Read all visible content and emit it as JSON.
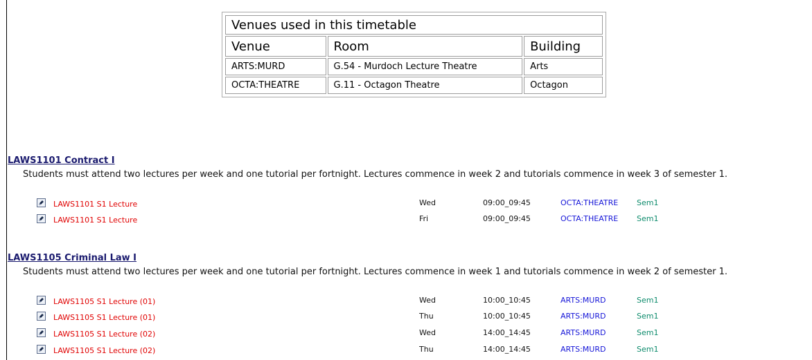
{
  "venues_table": {
    "caption": "Venues used in this timetable",
    "headers": {
      "venue": "Venue",
      "room": "Room",
      "building": "Building"
    },
    "rows": [
      {
        "venue": "ARTS:MURD",
        "room": "G.54 - Murdoch Lecture Theatre",
        "building": "Arts"
      },
      {
        "venue": "OCTA:THEATRE",
        "room": "G.11 - Octagon Theatre",
        "building": "Octagon"
      }
    ]
  },
  "courses": [
    {
      "title": "LAWS1101 Contract I",
      "description": "Students must attend two lectures per week and one tutorial per fortnight. Lectures commence in week 2 and tutorials commence in week 3 of semester 1.",
      "activities": [
        {
          "name": "LAWS1101 S1 Lecture",
          "day": "Wed",
          "time": "09:00_09:45",
          "venue": "OCTA:THEATRE",
          "semester": "Sem1"
        },
        {
          "name": "LAWS1101 S1 Lecture",
          "day": "Fri",
          "time": "09:00_09:45",
          "venue": "OCTA:THEATRE",
          "semester": "Sem1"
        }
      ]
    },
    {
      "title": "LAWS1105 Criminal Law I",
      "description": "Students must attend two lectures per week and one tutorial per fortnight. Lectures commence in week 1 and tutorials commence in week 2 of semester 1.",
      "activities": [
        {
          "name": "LAWS1105 S1 Lecture (01)",
          "day": "Wed",
          "time": "10:00_10:45",
          "venue": "ARTS:MURD",
          "semester": "Sem1"
        },
        {
          "name": "LAWS1105 S1 Lecture (01)",
          "day": "Thu",
          "time": "10:00_10:45",
          "venue": "ARTS:MURD",
          "semester": "Sem1"
        },
        {
          "name": "LAWS1105 S1 Lecture (02)",
          "day": "Wed",
          "time": "14:00_14:45",
          "venue": "ARTS:MURD",
          "semester": "Sem1"
        },
        {
          "name": "LAWS1105 S1 Lecture (02)",
          "day": "Thu",
          "time": "14:00_14:45",
          "venue": "ARTS:MURD",
          "semester": "Sem1"
        }
      ]
    }
  ],
  "icons": {
    "activity_icon": "edit-pen-icon"
  },
  "colors": {
    "activity_link": "#e00000",
    "venue_link": "#1515d8",
    "semester": "#0a8a6a",
    "course_title": "#1a1a6e"
  }
}
